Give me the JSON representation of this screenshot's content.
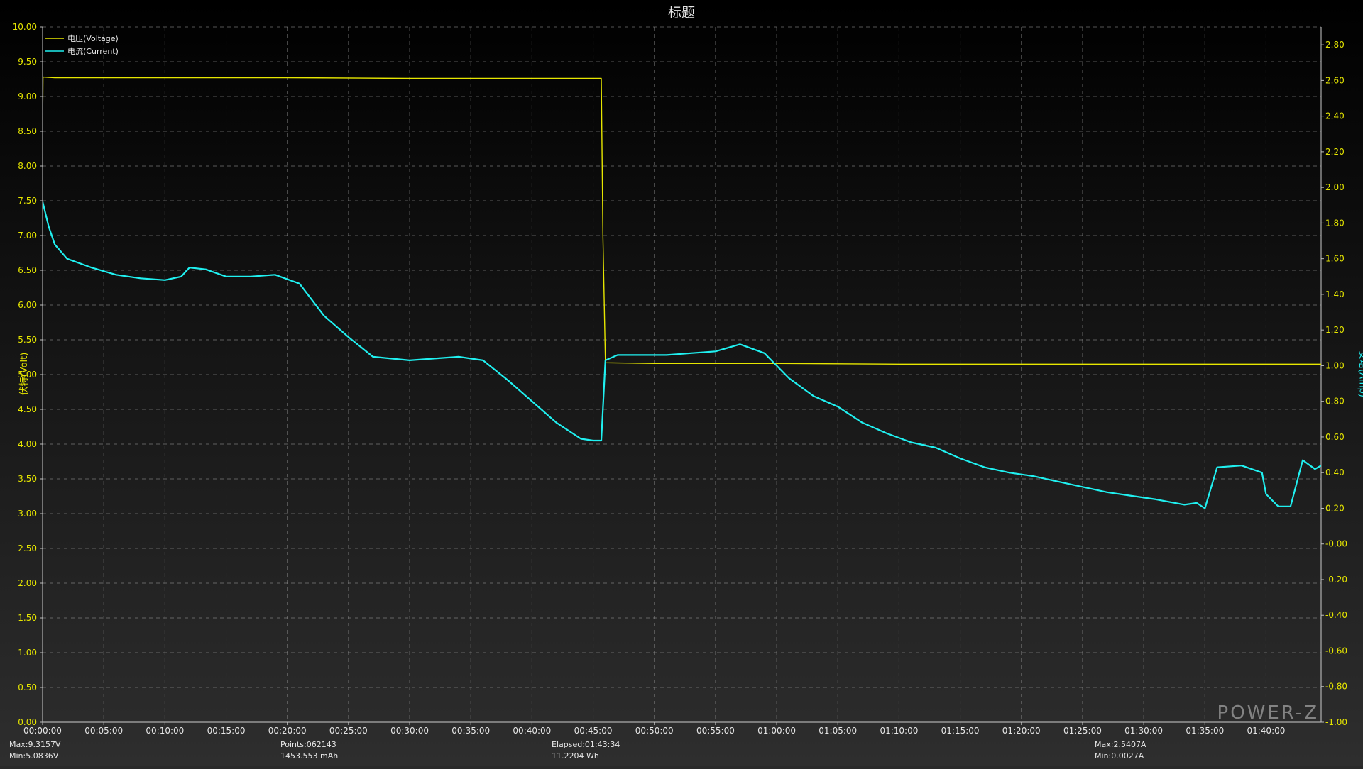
{
  "chart_data": {
    "type": "line",
    "title": "标题",
    "ylabel_left": "伏特(Volt)",
    "ylabel_right": "安培(Amp)",
    "ylim_left": [
      0,
      10
    ],
    "ylim_right": [
      -1.0,
      2.9
    ],
    "y_ticks_left": [
      "0.00",
      "0.50",
      "1.00",
      "1.50",
      "2.00",
      "2.50",
      "3.00",
      "3.50",
      "4.00",
      "4.50",
      "5.00",
      "5.50",
      "6.00",
      "6.50",
      "7.00",
      "7.50",
      "8.00",
      "8.50",
      "9.00",
      "9.50",
      "10.00"
    ],
    "y_ticks_right": [
      "-1.00",
      "-0.80",
      "-0.60",
      "-0.40",
      "-0.20",
      "-0.00",
      "0.20",
      "0.40",
      "0.60",
      "0.80",
      "1.00",
      "1.20",
      "1.40",
      "1.60",
      "1.80",
      "2.00",
      "2.20",
      "2.40",
      "2.60",
      "2.80"
    ],
    "x_ticks": [
      "00:00:00",
      "00:05:00",
      "00:10:00",
      "00:15:00",
      "00:20:00",
      "00:25:00",
      "00:30:00",
      "00:35:00",
      "00:40:00",
      "00:45:00",
      "00:50:00",
      "00:55:00",
      "01:00:00",
      "01:05:00",
      "01:10:00",
      "01:15:00",
      "01:20:00",
      "01:25:00",
      "01:30:00",
      "01:35:00",
      "01:40:00"
    ],
    "xlim_seconds": [
      0,
      6270
    ],
    "legend": {
      "placement": "top-left"
    },
    "grid": true,
    "series": [
      {
        "name": "电压(Voltage)",
        "axis": "left",
        "color": "#e6e600",
        "x_seconds": [
          0,
          2,
          60,
          600,
          1200,
          1800,
          2400,
          2740,
          2748,
          2760,
          3000,
          3600,
          4200,
          4800,
          5400,
          6000,
          6270
        ],
        "y": [
          8.5,
          9.28,
          9.27,
          9.27,
          9.27,
          9.26,
          9.26,
          9.26,
          7.0,
          5.17,
          5.16,
          5.16,
          5.15,
          5.15,
          5.15,
          5.15,
          5.15
        ]
      },
      {
        "name": "电流(Current)",
        "axis": "right",
        "color": "#20f0f0",
        "x_seconds": [
          0,
          30,
          60,
          120,
          240,
          360,
          480,
          600,
          680,
          720,
          800,
          900,
          1020,
          1140,
          1260,
          1380,
          1500,
          1620,
          1800,
          1920,
          2040,
          2160,
          2280,
          2400,
          2520,
          2640,
          2700,
          2740,
          2760,
          2820,
          2940,
          3060,
          3180,
          3300,
          3420,
          3540,
          3660,
          3780,
          3900,
          4020,
          4140,
          4260,
          4380,
          4500,
          4620,
          4740,
          4860,
          4980,
          5100,
          5220,
          5340,
          5460,
          5600,
          5660,
          5700,
          5760,
          5880,
          5980,
          6000,
          6060,
          6120,
          6180,
          6240,
          6270
        ],
        "y": [
          1.92,
          1.78,
          1.68,
          1.6,
          1.55,
          1.51,
          1.49,
          1.48,
          1.5,
          1.55,
          1.54,
          1.5,
          1.5,
          1.51,
          1.46,
          1.28,
          1.16,
          1.05,
          1.03,
          1.04,
          1.05,
          1.03,
          0.92,
          0.8,
          0.68,
          0.59,
          0.58,
          0.58,
          1.03,
          1.06,
          1.06,
          1.06,
          1.07,
          1.08,
          1.12,
          1.07,
          0.93,
          0.83,
          0.77,
          0.68,
          0.62,
          0.57,
          0.54,
          0.48,
          0.43,
          0.4,
          0.38,
          0.35,
          0.32,
          0.29,
          0.27,
          0.25,
          0.22,
          0.23,
          0.2,
          0.43,
          0.44,
          0.4,
          0.28,
          0.21,
          0.21,
          0.47,
          0.42,
          0.44
        ]
      }
    ]
  },
  "footer": {
    "max_voltage": "Max:9.3157V",
    "min_voltage": "Min:5.0836V",
    "points": "Points:062143",
    "capacity": "1453.553 mAh",
    "elapsed": "Elapsed:01:43:34",
    "energy": "11.2204 Wh",
    "max_current": "Max:2.5407A",
    "min_current": "Min:0.0027A"
  },
  "watermark": "POWER-Z",
  "colors": {
    "voltage": "#e6e600",
    "current": "#20f0f0",
    "background_top": "#000000",
    "background_bottom": "#2e2e2e"
  }
}
